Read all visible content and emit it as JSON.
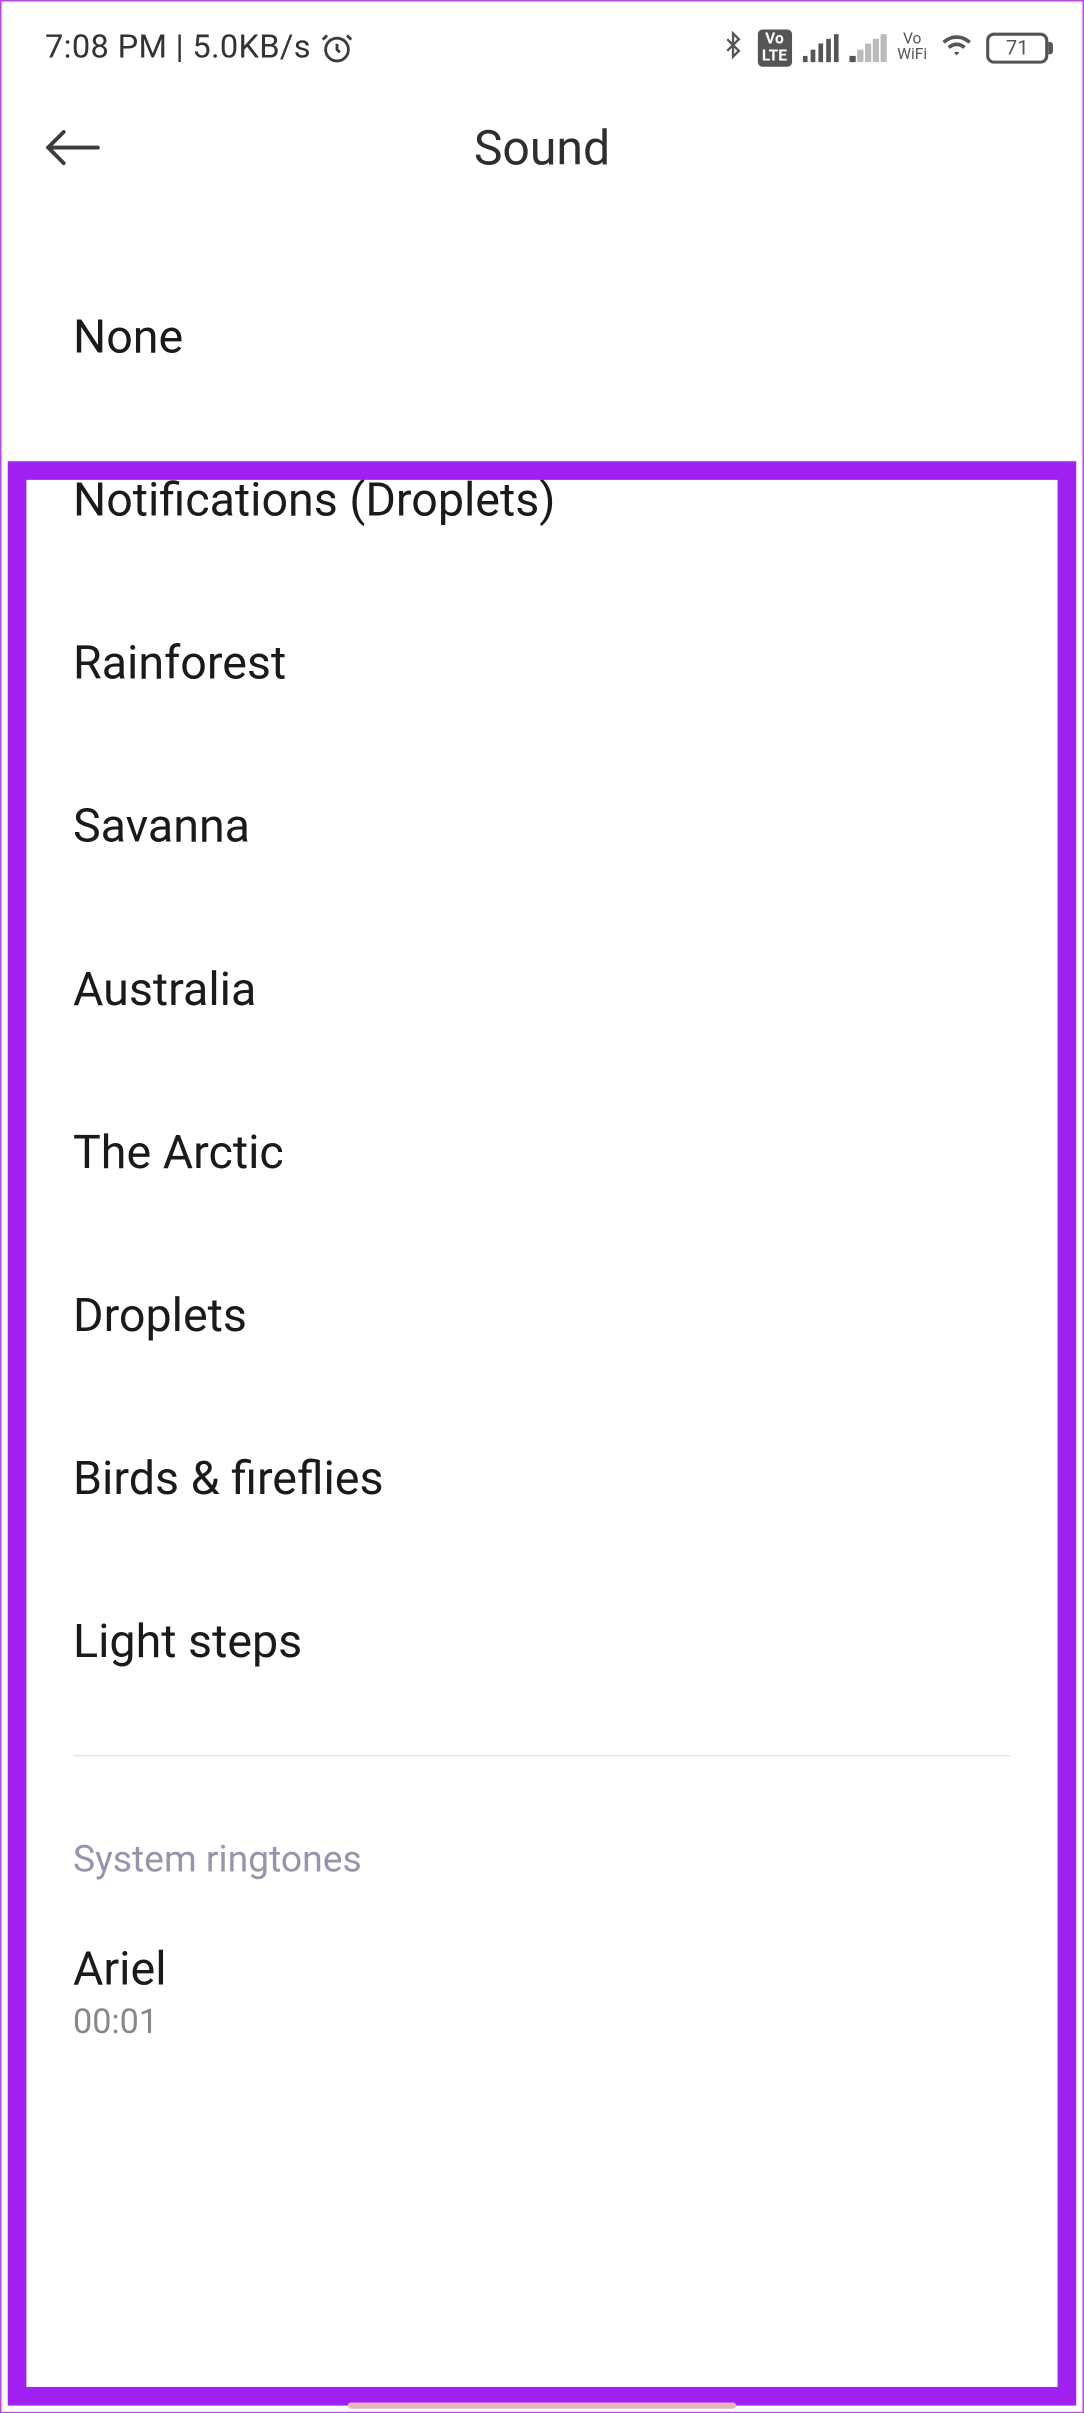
{
  "status": {
    "time": "7:08 PM",
    "speed": "5.0KB/s",
    "volte": "Vo\nLTE",
    "vowifi_top": "Vo",
    "vowifi_bottom": "WiFi",
    "battery": "71"
  },
  "header": {
    "title": "Sound"
  },
  "sounds": [
    "None",
    "Notifications (Droplets)",
    "Rainforest",
    "Savanna",
    "Australia",
    "The Arctic",
    "Droplets",
    "Birds & fireflies",
    "Light steps"
  ],
  "section_label": "System ringtones",
  "ringtones": [
    {
      "name": "Ariel",
      "duration": "00:01"
    }
  ]
}
